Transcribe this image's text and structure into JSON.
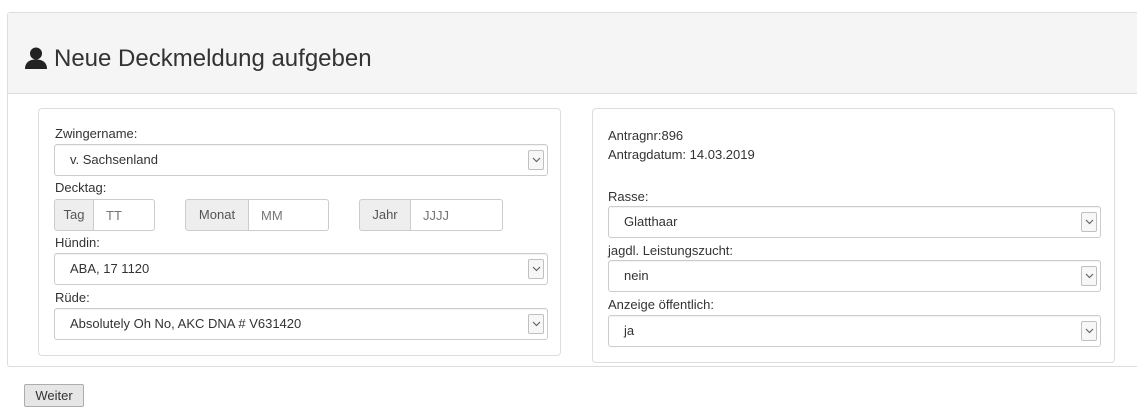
{
  "header": {
    "title": "Neue Deckmeldung aufgeben",
    "icon": "user-icon"
  },
  "left": {
    "zwingername_label": "Zwingername:",
    "zwingername_value": "v. Sachsenland",
    "decktag_label": "Decktag:",
    "tag_addon": "Tag",
    "tag_placeholder": "TT",
    "monat_addon": "Monat",
    "monat_placeholder": "MM",
    "jahr_addon": "Jahr",
    "jahr_placeholder": "JJJJ",
    "huendin_label": "Hündin:",
    "huendin_value": "ABA, 17 1120",
    "ruede_label": "Rüde:",
    "ruede_value": "Absolutely Oh No, AKC DNA # V631420"
  },
  "right": {
    "antragnr": "Antragnr:896",
    "antragdatum": "Antragdatum: 14.03.2019",
    "rasse_label": "Rasse:",
    "rasse_value": "Glatthaar",
    "leistung_label": "jagdl. Leistungszucht:",
    "leistung_value": "nein",
    "anzeige_label": "Anzeige öffentlich:",
    "anzeige_value": "ja"
  },
  "footer": {
    "weiter_label": "Weiter"
  },
  "colors": {
    "heading_bg": "#f5f5f5",
    "border": "#dddddd",
    "addon_bg": "#eeeeee",
    "text": "#333333"
  }
}
